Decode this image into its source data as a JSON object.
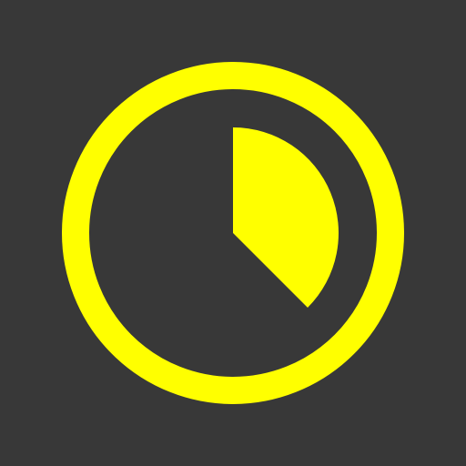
{
  "colors": {
    "background": "#383838",
    "accent": "#FFFF00"
  },
  "icon": {
    "name": "timer-icon",
    "progress_fraction": 0.375
  }
}
